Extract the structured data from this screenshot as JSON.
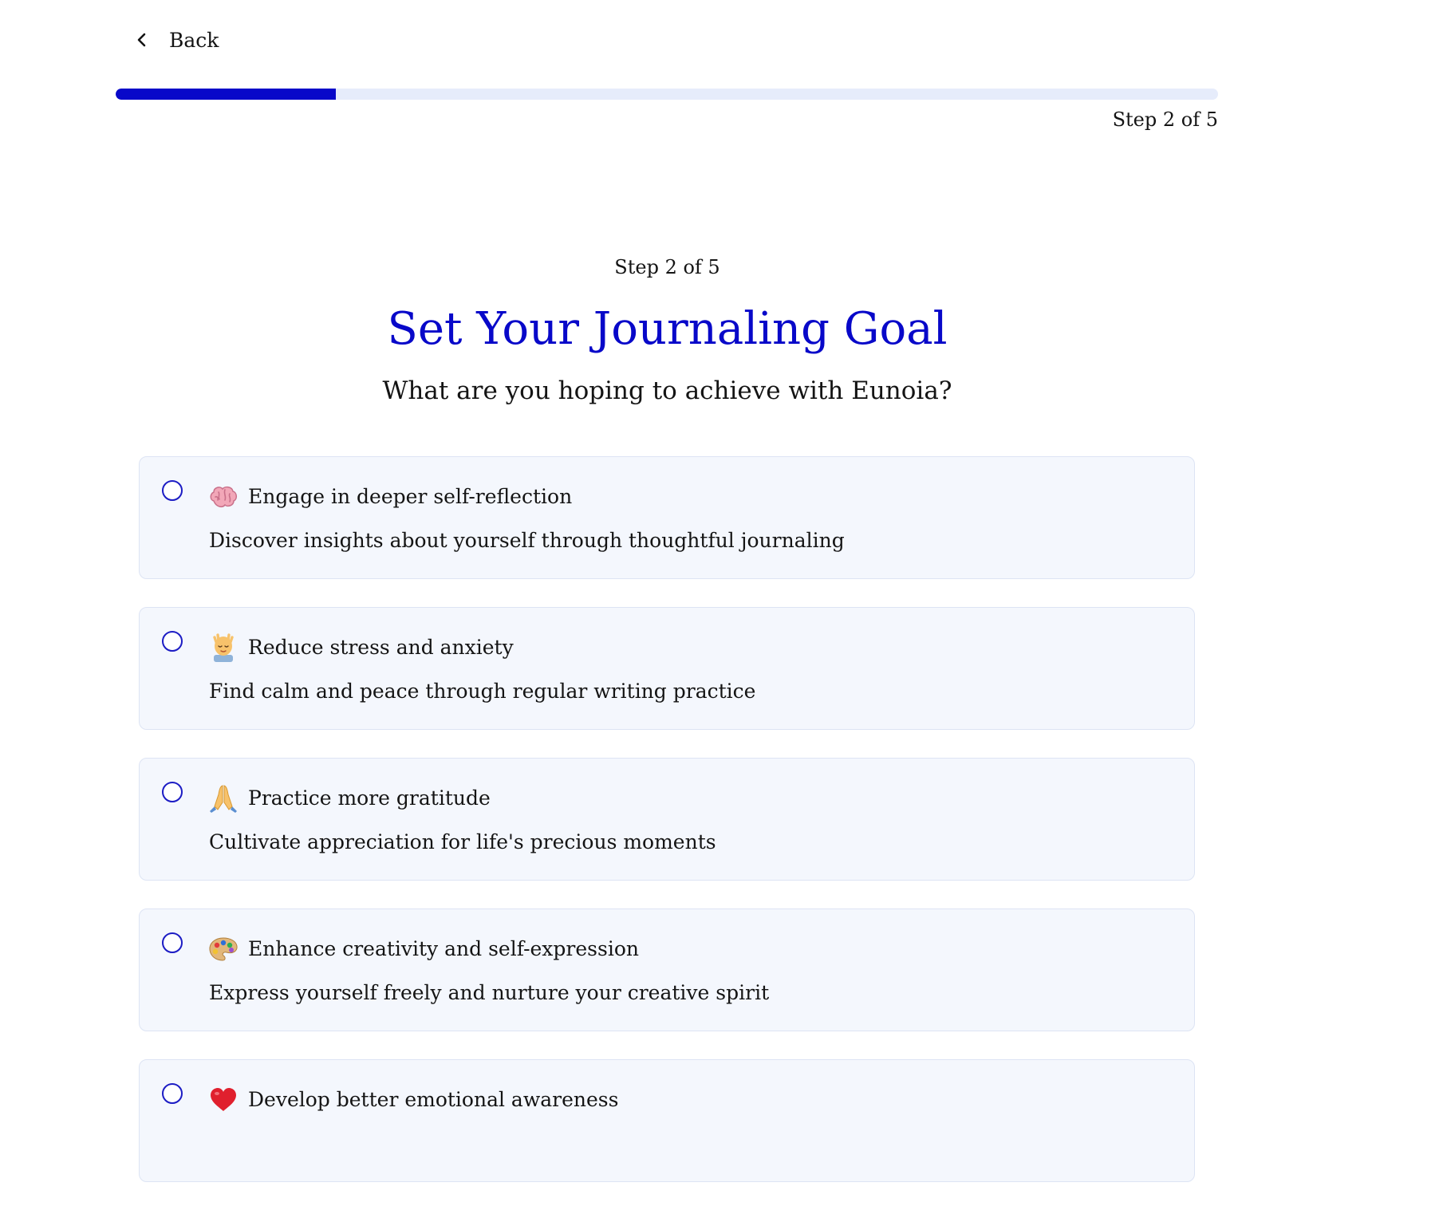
{
  "nav": {
    "back_label": "Back",
    "back_icon": "chevron-left-icon"
  },
  "progress": {
    "label": "Step 2 of 5",
    "fraction": 0.2,
    "color": "#0808c9",
    "track_color": "#e6ecfb"
  },
  "header": {
    "step": "Step 2 of 5",
    "title": "Set Your Journaling Goal",
    "subtitle": "What are you hoping to achieve with Eunoia?"
  },
  "colors": {
    "accent": "#0808c9",
    "card_bg": "#f4f7fd",
    "card_border": "#dde4f4",
    "text": "#141414"
  },
  "options": [
    {
      "icon": "brain-emoji-icon",
      "title": "Engage in deeper self-reflection",
      "description": "Discover insights about yourself through thoughtful journaling",
      "selected": false
    },
    {
      "icon": "face-massage-emoji-icon",
      "title": "Reduce stress and anxiety",
      "description": "Find calm and peace through regular writing practice",
      "selected": false
    },
    {
      "icon": "folded-hands-emoji-icon",
      "title": "Practice more gratitude",
      "description": "Cultivate appreciation for life's precious moments",
      "selected": false
    },
    {
      "icon": "artist-palette-emoji-icon",
      "title": "Enhance creativity and self-expression",
      "description": "Express yourself freely and nurture your creative spirit",
      "selected": false
    },
    {
      "icon": "red-heart-emoji-icon",
      "title": "Develop better emotional awareness",
      "description": "",
      "selected": false
    }
  ]
}
